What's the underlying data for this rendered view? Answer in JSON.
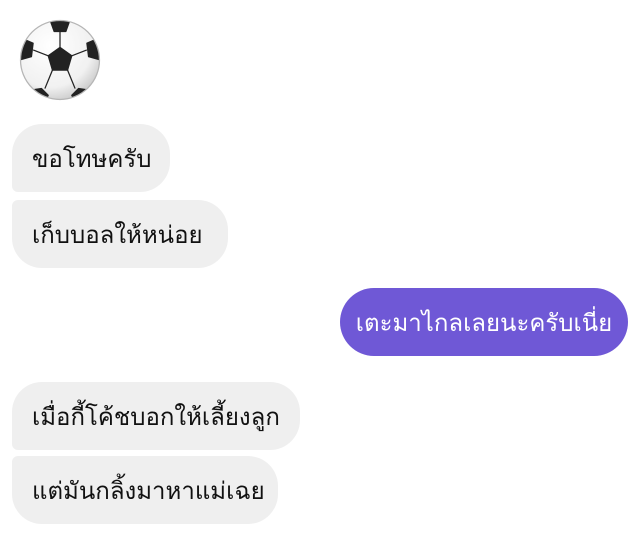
{
  "conversation": {
    "sticker": {
      "icon": "soccer-ball-icon"
    },
    "messages": [
      {
        "direction": "incoming",
        "text": "ขอโทษครับ"
      },
      {
        "direction": "incoming",
        "text": "เก็บบอลให้หน่อย"
      },
      {
        "direction": "outgoing",
        "text": "เตะมาไกลเลยนะครับเนี่ย"
      },
      {
        "direction": "incoming",
        "text": "เมื่อกี้โค้ชบอกให้เลี้ยงลูก"
      },
      {
        "direction": "incoming",
        "text": "แต่มันกลิ้งมาหาแม่เฉย"
      }
    ]
  },
  "colors": {
    "incoming_bubble": "#efefef",
    "outgoing_bubble": "#6f58d6",
    "incoming_text": "#111111",
    "outgoing_text": "#ffffff"
  }
}
